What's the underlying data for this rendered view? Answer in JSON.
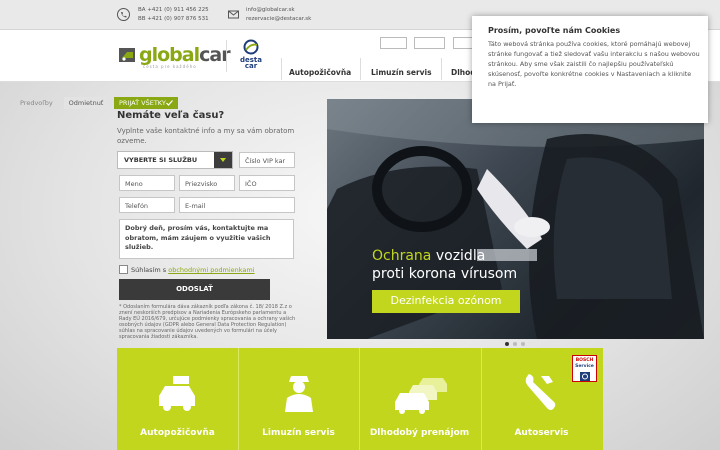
{
  "topbar": {
    "phone_line1": "BA +421 (0) 911 456 225",
    "phone_line2": "BB +421 (0) 907 876 531",
    "email_line1": "info@globalcar.sk",
    "email_line2": "rezervacie@destacar.sk"
  },
  "header": {
    "logo_global": "global",
    "logo_car": "car",
    "logo_tagline": "cesta pre každého",
    "desta_line1": "desta",
    "desta_line2": "car",
    "nav": [
      "Autopožičovňa",
      "Limuzín servis",
      "Dlhodo"
    ]
  },
  "form": {
    "title": "Nemáte veľa času?",
    "subtitle": "Vyplnte vaše kontaktné info a my sa vám obratom ozveme.",
    "service_select": "VYBERTE SI SLUŽBU",
    "vip_placeholder": "Číslo VIP kar",
    "name_placeholder": "Meno",
    "surname_placeholder": "Priezvisko",
    "ico_placeholder": "IČO",
    "phone_placeholder": "Telefón",
    "email_placeholder": "E-mail",
    "message": "Dobrý deň, prosím vás, kontaktujte ma obratom, mám záujem o využitie vašich služieb.",
    "consent_prefix": "Súhlasím s",
    "consent_link": "obchodnými podmienkami",
    "submit": "ODOSLAŤ",
    "disclaimer": "* Odoslaním formulára dáva zákazník podľa zákona č. 18/ 2018 Z.z o znení neskorších predpisov a Nariadenia Európskeho parlamentu a Rady EÚ 2016/679, určujúce podmienky spracovania a ochrany vašich osobných údajov (GDPR alebo General Data Protection Regulation) súhlas na spracovanie údajov uvedených vo formulári na účely spracovania žiadosti zákazníka."
  },
  "hero": {
    "line1_accent": "Ochrana",
    "line1_rest": " vozidla",
    "line2": "proti korona vírusom",
    "cta": "Dezinfekcia ozónom",
    "slides_total": 3,
    "active_slide": 1
  },
  "services": {
    "items": [
      {
        "label": "Autopožičovňa",
        "icon": "car-rental-icon"
      },
      {
        "label": "Limuzín servis",
        "icon": "chauffeur-icon"
      },
      {
        "label": "Dlhodobý prenájom",
        "icon": "fleet-icon"
      },
      {
        "label": "Autoservis",
        "icon": "wrench-icon"
      }
    ],
    "bosch_line1": "BOSCH",
    "bosch_line2": "Service"
  },
  "cookie": {
    "title": "Prosím, povoľte nám Cookies",
    "body": "Táto webová stránka používa cookies, ktoré pomáhajú webovej stránke fungovať a tiež sledovať vašu interakciu s našou webovou stránkou. Aby sme však zaistili čo najlepšiu používateľskú skúsenosť, povoľte konkrétne cookies v Nastaveniach a kliknite na Prijať.",
    "prefs": "Predvoľby",
    "reject": "Odmietnuť",
    "accept": "PRIJAŤ VŠETKY"
  },
  "colors": {
    "accent": "#c2d61e",
    "brand_green": "#8aa814",
    "dark": "#3a3a3a"
  }
}
